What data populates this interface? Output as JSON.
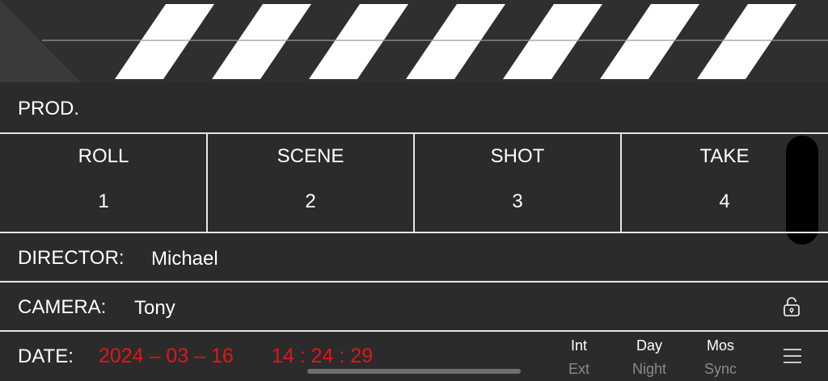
{
  "clapper": {
    "stripe_color": "#ffffff",
    "stripe_count": 7
  },
  "prod": {
    "label": "PROD.",
    "value": ""
  },
  "grid": [
    {
      "key": "roll",
      "label": "ROLL",
      "value": "1"
    },
    {
      "key": "scene",
      "label": "SCENE",
      "value": "2"
    },
    {
      "key": "shot",
      "label": "SHOT",
      "value": "3"
    },
    {
      "key": "take",
      "label": "TAKE",
      "value": "4"
    }
  ],
  "director": {
    "label": "DIRECTOR:",
    "value": "Michael"
  },
  "camera": {
    "label": "CAMERA:",
    "value": "Tony",
    "lock_icon": "lock-icon"
  },
  "date": {
    "label": "DATE:",
    "date_value": "2024 – 03 – 16",
    "time_value": "14 : 24 : 29",
    "value_color": "#e0161b"
  },
  "toggles": [
    {
      "top": "Int",
      "bottom": "Ext"
    },
    {
      "top": "Day",
      "bottom": "Night"
    },
    {
      "top": "Mos",
      "bottom": "Sync"
    }
  ],
  "menu_icon": "hamburger-menu-icon"
}
